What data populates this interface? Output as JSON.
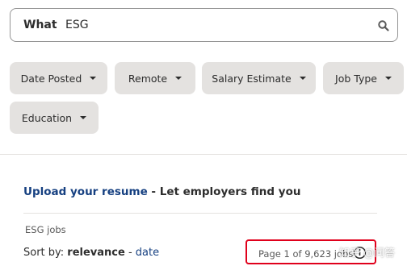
{
  "search": {
    "label": "What",
    "value": "ESG",
    "icon": "search-icon"
  },
  "filters": [
    {
      "label": "Date Posted"
    },
    {
      "label": "Remote"
    },
    {
      "label": "Salary Estimate"
    },
    {
      "label": "Job Type"
    },
    {
      "label": "Education"
    }
  ],
  "upload": {
    "link_text": "Upload your resume",
    "rest_text": " - Let employers find you"
  },
  "results": {
    "jobs_label": "ESG jobs",
    "sort_prefix": "Sort by: ",
    "sort_active": "relevance",
    "sort_separator": " - ",
    "sort_other": "date",
    "page_count": "Page 1 of 9,623 jobs"
  },
  "watermark": "知乎 @问答",
  "colors": {
    "link": "#164081",
    "chip_bg": "#e4e2e0",
    "highlight_box": "#e0001b"
  }
}
